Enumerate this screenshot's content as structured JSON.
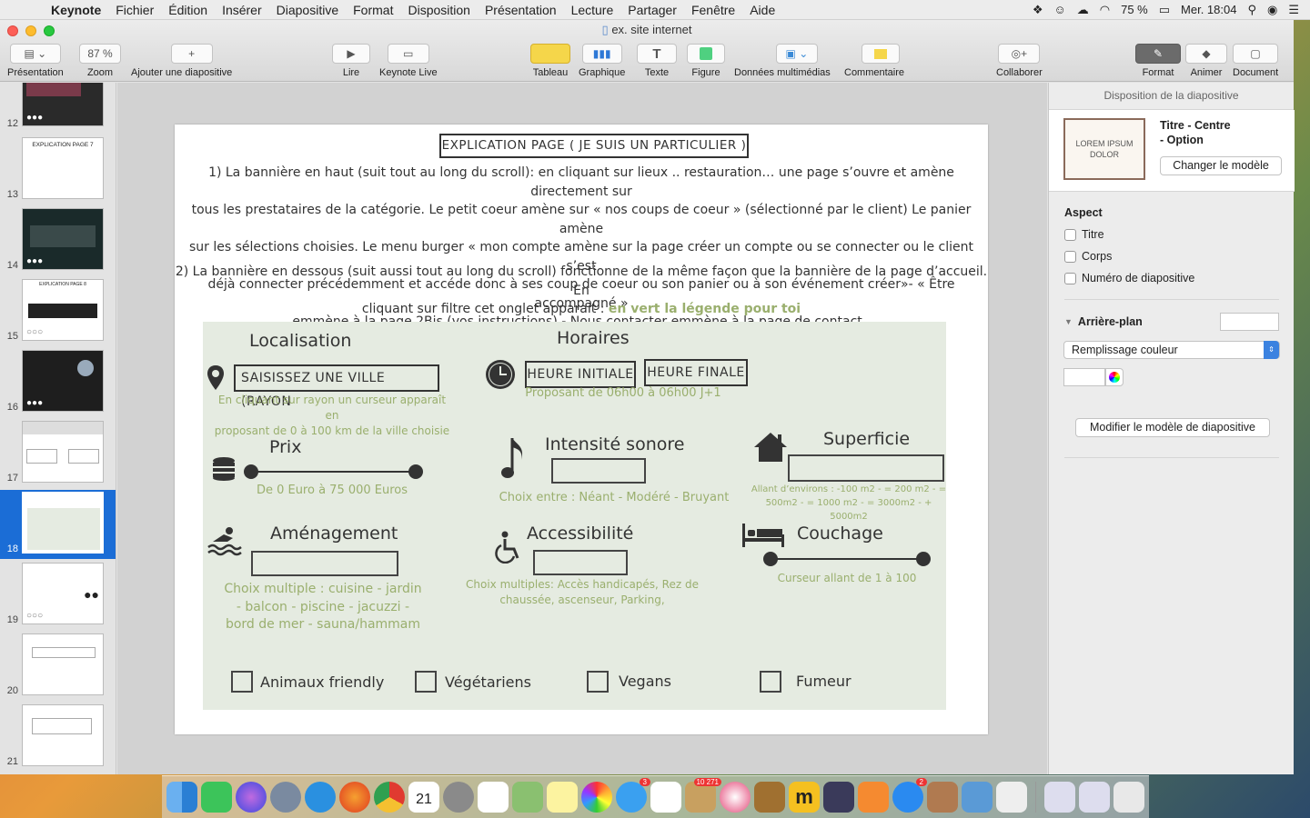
{
  "menubar": {
    "app": "Keynote",
    "items": [
      "Fichier",
      "Édition",
      "Insérer",
      "Diapositive",
      "Format",
      "Disposition",
      "Présentation",
      "Lecture",
      "Partager",
      "Fenêtre",
      "Aide"
    ],
    "battery": "75 %",
    "clock": "Mer. 18:04"
  },
  "window": {
    "title": "ex. site internet"
  },
  "toolbar": {
    "presentation": "Présentation",
    "zoom_value": "87 %",
    "zoom": "Zoom",
    "add_slide": "Ajouter une diapositive",
    "play": "Lire",
    "keynote_live": "Keynote Live",
    "table": "Tableau",
    "chart": "Graphique",
    "text": "Texte",
    "shape": "Figure",
    "media": "Données multimédias",
    "comment": "Commentaire",
    "collaborate": "Collaborer",
    "format": "Format",
    "animate": "Animer",
    "document": "Document"
  },
  "navigator": {
    "slides": [
      {
        "num": "12"
      },
      {
        "num": "13",
        "title": "EXPLICATION PAGE 7"
      },
      {
        "num": "14"
      },
      {
        "num": "15",
        "title": "EXPLICATION PAGE 8"
      },
      {
        "num": "16"
      },
      {
        "num": "17"
      },
      {
        "num": "18"
      },
      {
        "num": "19"
      },
      {
        "num": "20"
      },
      {
        "num": "21"
      }
    ]
  },
  "slide": {
    "title": "EXPLICATION PAGE ( JE SUIS UN PARTICULIER )",
    "p1_l1": "1) La bannière en haut (suit tout au long du scroll): en cliquant sur lieux .. restauration… une page s’ouvre et amène directement sur",
    "p1_l2": "tous les prestataires de la catégorie. Le petit coeur amène sur « nos coups de coeur » (sélectionné par le client) Le panier amène",
    "p1_l3": "sur les sélections choisies. Le menu burger « mon compte amène sur la page créer un compte ou se connecter ou le client s’est",
    "p1_l4": "déjà connecter précédemment et accéde donc à ses coup de coeur ou son panier ou à son événement créer»- « Être accompagné »",
    "p1_l5": "emmène à la page 2Bis (vos instructions) - Nous contacter emmène à la page de contact .",
    "p2_l1": "2) La bannière en dessous (suit aussi tout au long du scroll) fonctionne de la même façon que la bannière de la page d’accueil. En",
    "p2_l2": "cliquant sur filtre cet onglet apparait :",
    "p2_green": "en vert la légende pour toi",
    "panel": {
      "loc_title": "Localisation",
      "loc_field": "SAISISSEZ UNE VILLE  (RAYON",
      "loc_desc1": "En cliquant sur rayon un curseur apparaît en",
      "loc_desc2": "proposant de 0 à 100 km de la ville choisie",
      "hours_title": "Horaires",
      "hours_start": "HEURE INITIALE",
      "hours_end": "HEURE FINALE",
      "hours_desc": "Proposant de 06h00 à 06h00 J+1",
      "price_title": "Prix",
      "price_desc": "De 0 Euro à 75 000 Euros",
      "sound_title": "Intensité sonore",
      "sound_desc": "Choix entre : Néant - Modéré - Bruyant",
      "area_title": "Superficie",
      "area_desc1": "Allant d’environs : -100 m2 - = 200 m2 - =",
      "area_desc2": "500m2 - = 1000 m2 - = 3000m2 - + 5000m2",
      "amen_title": "Aménagement",
      "amen_desc1": "Choix multiple : cuisine - jardin",
      "amen_desc2": "- balcon - piscine - jacuzzi -",
      "amen_desc3": "bord de mer - sauna/hammam",
      "access_title": "Accessibilité",
      "access_desc1": "Choix multiples: Accès handicapés, Rez de",
      "access_desc2": "chaussée, ascenseur, Parking,",
      "bed_title": "Couchage",
      "bed_desc": "Curseur allant de 1 à 100",
      "cb1": "Animaux friendly",
      "cb2": "Végétariens",
      "cb3": "Vegans",
      "cb4": "Fumeur"
    }
  },
  "inspector": {
    "header": "Disposition de la diapositive",
    "master_thumb": "LOREM IPSUM DOLOR",
    "master_name_l1": "Titre - Centre",
    "master_name_l2": "- Option",
    "change_master": "Changer le modèle",
    "aspect": "Aspect",
    "opt_title": "Titre",
    "opt_body": "Corps",
    "opt_number": "Numéro de diapositive",
    "background": "Arrière-plan",
    "fill": "Remplissage couleur",
    "edit_master": "Modifier le modèle de diapositive"
  },
  "dock": {
    "badge_messages": "3",
    "badge_notes": "10 271",
    "badge_appstore": "2",
    "calendar_day": "21"
  }
}
